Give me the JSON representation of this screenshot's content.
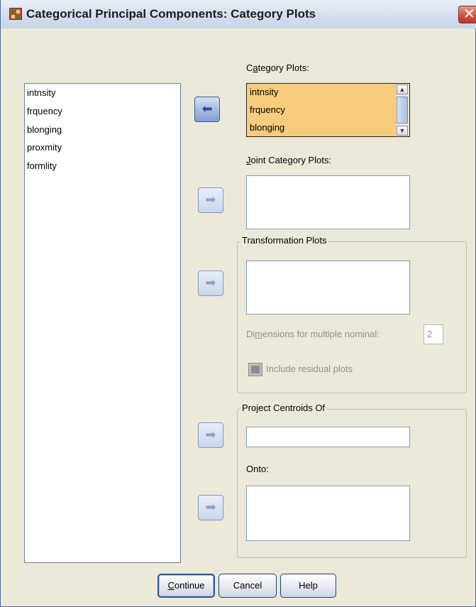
{
  "window": {
    "title": "Categorical Principal Components: Category Plots"
  },
  "source_variables": [
    "intnsity",
    "frquency",
    "blonging",
    "proxmity",
    "formlity"
  ],
  "category_plots": {
    "label_pre": "C",
    "label_u": "a",
    "label_post": "tegory Plots:",
    "items": [
      "intnsity",
      "frquency",
      "blonging"
    ]
  },
  "joint_category_plots": {
    "label_pre": "",
    "label_u": "J",
    "label_post": "oint Category Plots:"
  },
  "transformation_plots": {
    "title": "Transformation Plots",
    "dimensions_label_pre": "Di",
    "dimensions_label_u": "m",
    "dimensions_label_post": "ensions for multiple nominal:",
    "dimensions_value": "2",
    "residual_label_pre": "Include",
    "residual_label_u": "",
    "residual_label_post": "",
    "residual_full": "Include residual plots"
  },
  "project_centroids": {
    "title": "Project Centroids Of",
    "onto_label": "Onto:"
  },
  "buttons": {
    "continue_u": "C",
    "continue_rest": "ontinue",
    "cancel": "Cancel",
    "help": "Help"
  },
  "icons": {
    "move_right": "➜",
    "move_left": "🡄"
  }
}
